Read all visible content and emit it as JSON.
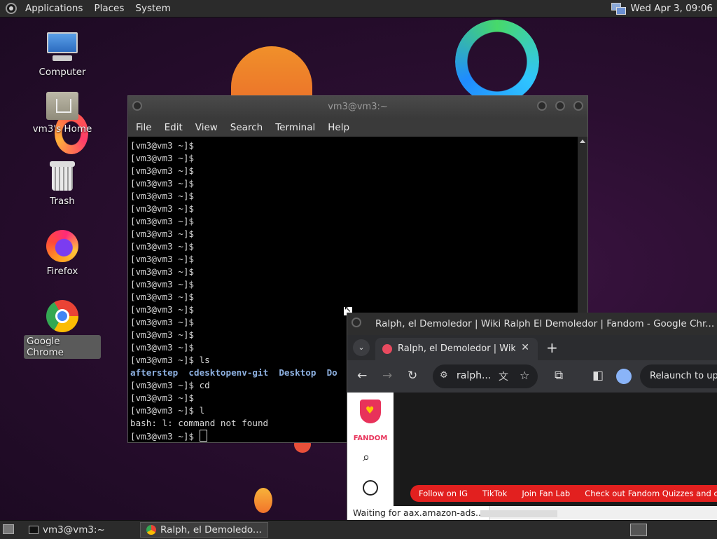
{
  "top_panel": {
    "menus": [
      "Applications",
      "Places",
      "System"
    ],
    "clock": "Wed Apr  3, 09:06"
  },
  "desktop_icons": [
    {
      "label": "Computer",
      "icon": "computer-icon"
    },
    {
      "label": "vm3's Home",
      "icon": "home-folder-icon"
    },
    {
      "label": "Trash",
      "icon": "trash-icon"
    },
    {
      "label": "Firefox",
      "icon": "firefox-icon"
    },
    {
      "label": "Google Chrome",
      "icon": "chrome-icon"
    }
  ],
  "terminal": {
    "title": "vm3@vm3:~",
    "menus": [
      "File",
      "Edit",
      "View",
      "Search",
      "Terminal",
      "Help"
    ],
    "prompt": "[vm3@vm3 ~]$",
    "ls_output": [
      "afterstep",
      "cdesktopenv-git",
      "Desktop",
      "Do"
    ],
    "commands": {
      "ls": "ls",
      "cd": "cd",
      "l": "l"
    },
    "error": "bash: l: command not found"
  },
  "chrome": {
    "window_title": "Ralph, el Demoledor | Wiki Ralph El Demoledor | Fandom - Google Chr...",
    "tab_title": "Ralph, el Demoledor | Wiki Ra",
    "url": "ralph...",
    "relaunch": "Relaunch to upda",
    "fandom_label": "FANDOM",
    "promo_links": [
      "Follow on IG",
      "TikTok",
      "Join Fan Lab",
      "Check out Fandom Quizzes and cha"
    ],
    "status": "Waiting for aax.amazon-ads..."
  },
  "taskbar": {
    "items": [
      {
        "label": "vm3@vm3:~"
      },
      {
        "label": "Ralph, el Demoledo..."
      }
    ]
  }
}
